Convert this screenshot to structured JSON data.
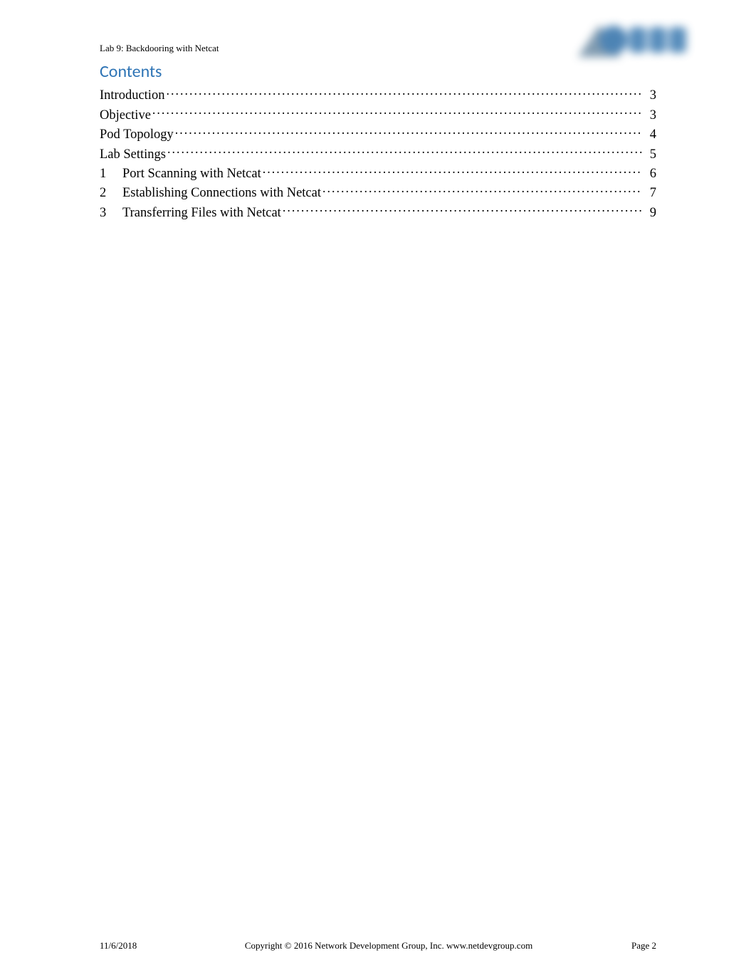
{
  "header": {
    "lab_label": "Lab 9: Backdooring with Netcat",
    "contents_title": "Contents"
  },
  "toc": [
    {
      "num": "",
      "title": "Introduction",
      "page": "3"
    },
    {
      "num": "",
      "title": "Objective",
      "page": "3"
    },
    {
      "num": "",
      "title": "Pod Topology",
      "page": "4"
    },
    {
      "num": "",
      "title": "Lab Settings",
      "page": "5"
    },
    {
      "num": "1",
      "title": "Port Scanning with Netcat",
      "page": "6"
    },
    {
      "num": "2",
      "title": "Establishing Connections with Netcat",
      "page": "7"
    },
    {
      "num": "3",
      "title": "Transferring Files with Netcat",
      "page": "9"
    }
  ],
  "footer": {
    "date": "11/6/2018",
    "copyright": "Copyright © 2016 Network Development Group, Inc.  www.netdevgroup.com",
    "page": "Page 2"
  }
}
